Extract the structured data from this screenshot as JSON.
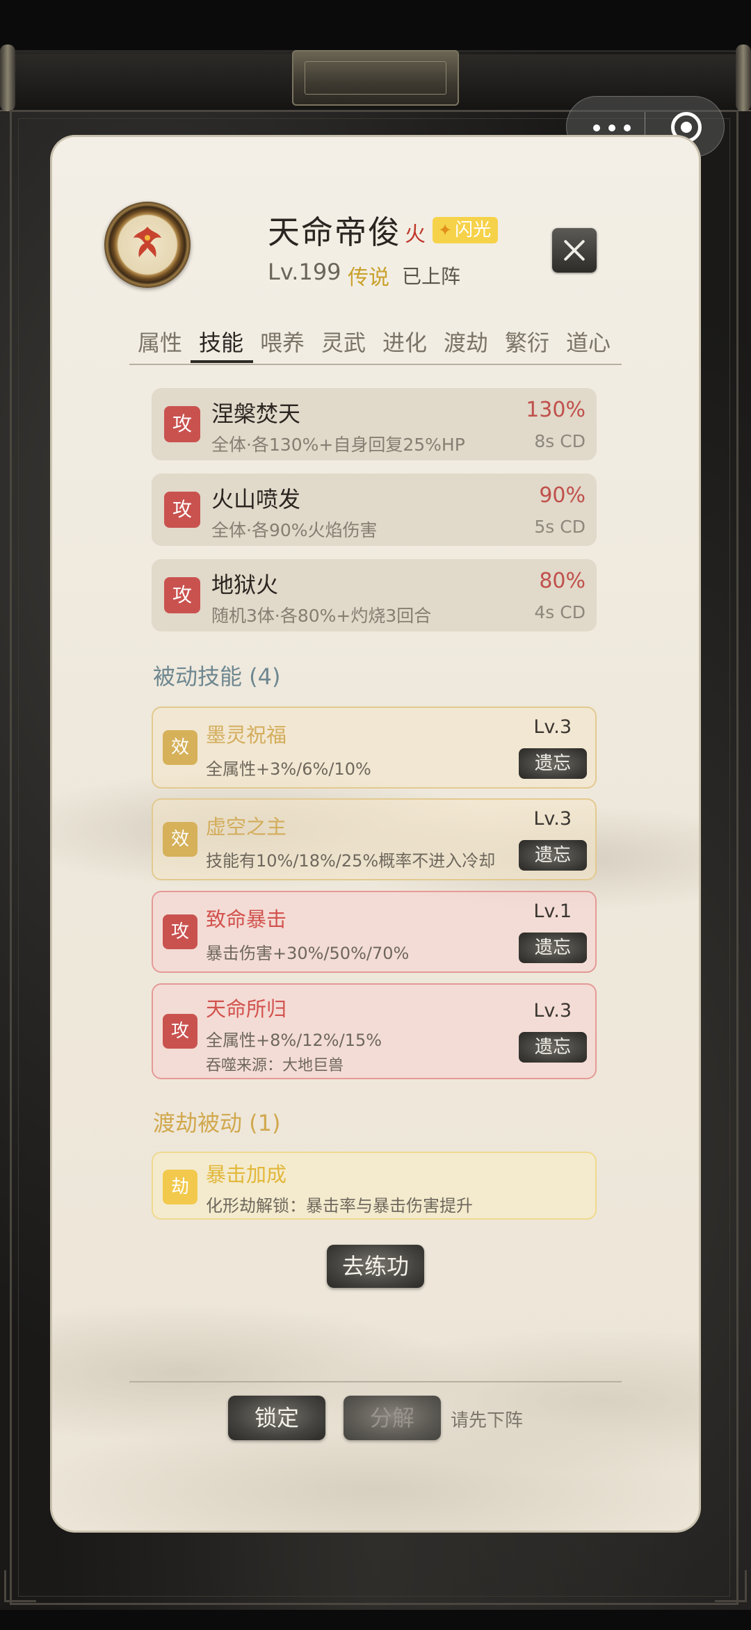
{
  "character": {
    "name": "天命帝俊",
    "element": "火",
    "shine_badge": "闪光",
    "level": "Lv.199",
    "rarity": "传说",
    "deploy_status": "已上阵"
  },
  "tabs": [
    "属性",
    "技能",
    "喂养",
    "灵武",
    "进化",
    "渡劫",
    "繁衍",
    "道心"
  ],
  "active_tab": "技能",
  "active_skills": [
    {
      "badge": "攻",
      "name": "涅槃焚天",
      "desc": "全体·各130%+自身回复25%HP",
      "pct": "130%",
      "cd": "8s CD"
    },
    {
      "badge": "攻",
      "name": "火山喷发",
      "desc": "全体·各90%火焰伤害",
      "pct": "90%",
      "cd": "5s CD"
    },
    {
      "badge": "攻",
      "name": "地狱火",
      "desc": "随机3体·各80%+灼烧3回合",
      "pct": "80%",
      "cd": "4s CD"
    }
  ],
  "passive_section": "被动技能 (4)",
  "passives": [
    {
      "badge": "效",
      "name": "墨灵祝福",
      "desc": "全属性+3%/6%/10%",
      "level": "Lv.3",
      "action": "遗忘"
    },
    {
      "badge": "效",
      "name": "虚空之主",
      "desc": "技能有10%/18%/25%概率不进入冷却",
      "level": "Lv.3",
      "action": "遗忘"
    },
    {
      "badge": "攻",
      "name": "致命暴击",
      "desc": "暴击伤害+30%/50%/70%",
      "level": "Lv.1",
      "action": "遗忘"
    },
    {
      "badge": "攻",
      "name": "天命所归",
      "desc": "全属性+8%/12%/15%",
      "source": "吞噬来源：大地巨兽",
      "level": "Lv.3",
      "action": "遗忘"
    }
  ],
  "tribulation_section": "渡劫被动 (1)",
  "tribulation": {
    "badge": "劫",
    "name": "暴击加成",
    "desc": "化形劫解锁：暴击率与暴击伤害提升"
  },
  "train_button": "去练功",
  "footer": {
    "lock": "锁定",
    "decompose": "分解",
    "hint": "请先下阵"
  },
  "colors": {
    "attack": "#c9524f",
    "effect": "#d6b15a",
    "tribulation": "#f2c94c",
    "rarity": "#c9a12c"
  }
}
